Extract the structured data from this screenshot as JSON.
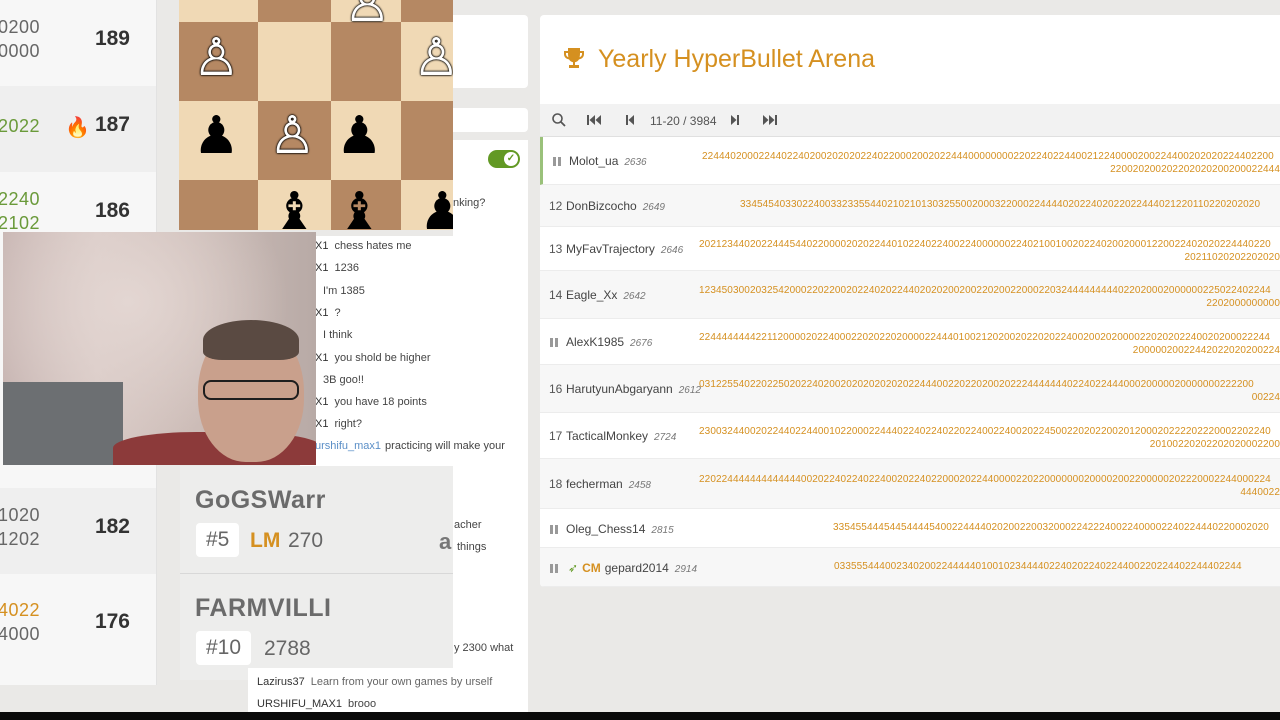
{
  "left_standings": [
    {
      "score_top": "0200",
      "score_bottom": "0000",
      "points": "189",
      "fire": false
    },
    {
      "score_top": "2022",
      "score_bottom": "",
      "points": "187",
      "fire": true
    },
    {
      "score_top": "2240",
      "score_bottom": "2102",
      "points": "186",
      "fire": false
    },
    {
      "score_top": "1020",
      "score_bottom": "1202",
      "points": "182",
      "fire": false
    },
    {
      "score_top": "4022",
      "score_bottom": "4000",
      "points": "176",
      "fire": false
    }
  ],
  "chat": {
    "top_fragment": "nking?",
    "lines": [
      {
        "user": "X1",
        "text": "chess hates me"
      },
      {
        "user": "X1",
        "text": "1236"
      },
      {
        "user": "",
        "text": "I'm 1385"
      },
      {
        "user": "X1",
        "text": "?"
      },
      {
        "user": "",
        "text": "I think"
      },
      {
        "user": "X1",
        "text": "you shold be higher"
      },
      {
        "user": "",
        "text": "3B goo!!"
      },
      {
        "user": "X1",
        "text": "you have 18 points"
      },
      {
        "user": "X1",
        "text": "right?"
      }
    ],
    "link_line": {
      "user": "urshifu_max1",
      "text": "practicing will make your"
    },
    "frag_teacher": "acher",
    "frag_things": "things",
    "frag_a": "a",
    "frag_2300": "y 2300 what",
    "line_learn": {
      "user": "Lazirus37",
      "text": "Learn from your own games by urself"
    },
    "line_brooo": {
      "user": "URSHIFU_MAX1",
      "text": "brooo"
    }
  },
  "player_cards": [
    {
      "name": "GoGSWarr",
      "rank": "#5",
      "title": "LM",
      "rating": "270"
    },
    {
      "name": "FARMVILLI",
      "rank": "#10",
      "title": "",
      "rating": "2788"
    }
  ],
  "arena": {
    "title": "Yearly HyperBullet Arena",
    "trophy_icon": "trophy-icon",
    "pager": {
      "info": "11-20 / 3984"
    },
    "rows": [
      {
        "rank": "",
        "paused": true,
        "title": "",
        "name": "Molot_ua",
        "elo": "2636",
        "line1": "22444020002244022402002020202240220002002022444000000002202240224400212240000200224400202020224402200",
        "line2": "220020200202202020200200022444"
      },
      {
        "rank": "12",
        "paused": false,
        "title": "",
        "name": "DonBizcocho",
        "elo": "2649",
        "line1": "33454540330224003323355440210210130325500200032200022444402022402022022444021220110220202020",
        "line2": ""
      },
      {
        "rank": "13",
        "paused": false,
        "title": "",
        "name": "MyFavTrajectory",
        "elo": "2646",
        "line1": "20212344020224445440220000202022440102240224002240000002240210010020224020020001220022402020224440220",
        "line2": "20211020202202020"
      },
      {
        "rank": "14",
        "paused": false,
        "title": "",
        "name": "Eagle_Xx",
        "elo": "2642",
        "line1": "12345030020325420002202200202240202244020202002002202002200022032444444444022020002000000225022402244",
        "line2": "2202000000000"
      },
      {
        "rank": "",
        "paused": true,
        "title": "",
        "name": "AlexK1985",
        "elo": "2676",
        "line1": "22444444442211200002022400022020220200002244401002120200202202022400200202000022020202240020200022244",
        "line2": "20000020022442022020200224"
      },
      {
        "rank": "16",
        "paused": false,
        "title": "",
        "name": "HarutyunAbgaryann",
        "elo": "2612",
        "line1": "03122554022022502022402002020202020202244400220220200202224444444022402244400020000020000000222200",
        "line2": "00224"
      },
      {
        "rank": "17",
        "paused": false,
        "title": "",
        "name": "TacticalMonkey",
        "elo": "2724",
        "line1": "23003244002022440224400102200022444022402240220224002240020224500220202200201200020222202220002202240",
        "line2": "20100220202202020002200"
      },
      {
        "rank": "18",
        "paused": false,
        "title": "",
        "name": "fecherman",
        "elo": "2458",
        "line1": "22022444444444444400202240224022400202240220002022440000220220000000200002002200000202220002244000224",
        "line2": "4440022"
      },
      {
        "rank": "",
        "paused": true,
        "title": "",
        "name": "Oleg_Chess14",
        "elo": "2815",
        "line1": "33545544454454444540022444402020022003200022422240022400002240224440220002020",
        "line2": ""
      },
      {
        "rank": "",
        "paused": true,
        "title": "CM",
        "name": "gepard2014",
        "elo": "2914",
        "line1": "033555444002340200224444401001023444402240202240224400220224402244402244",
        "line2": ""
      }
    ]
  }
}
